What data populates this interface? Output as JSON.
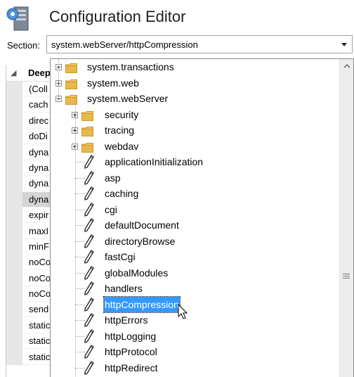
{
  "header": {
    "title": "Configuration Editor",
    "icon": "server-config-icon"
  },
  "section": {
    "label": "Section:",
    "value": "system.webServer/httpCompression"
  },
  "grid": {
    "header_label": "Deep",
    "rows": [
      "(Coll",
      "cach",
      "direc",
      "doDi",
      "dyna",
      "dyna",
      "dyna",
      "dyna",
      "expir",
      "maxI",
      "minF",
      "noCo",
      "noCo",
      "noCo",
      "send",
      "static",
      "static",
      "static"
    ],
    "selected_row_index": 7
  },
  "tree": {
    "items": [
      {
        "label": "system.transactions",
        "kind": "folder",
        "expander": "plus"
      },
      {
        "label": "system.web",
        "kind": "folder",
        "expander": "plus"
      },
      {
        "label": "system.webServer",
        "kind": "folder",
        "expander": "minus"
      },
      {
        "label": "security",
        "kind": "folder",
        "expander": "plus"
      },
      {
        "label": "tracing",
        "kind": "folder",
        "expander": "plus"
      },
      {
        "label": "webdav",
        "kind": "folder",
        "expander": "plus"
      },
      {
        "label": "applicationInitialization",
        "kind": "section"
      },
      {
        "label": "asp",
        "kind": "section"
      },
      {
        "label": "caching",
        "kind": "section"
      },
      {
        "label": "cgi",
        "kind": "section"
      },
      {
        "label": "defaultDocument",
        "kind": "section"
      },
      {
        "label": "directoryBrowse",
        "kind": "section"
      },
      {
        "label": "fastCgi",
        "kind": "section"
      },
      {
        "label": "globalModules",
        "kind": "section"
      },
      {
        "label": "handlers",
        "kind": "section"
      },
      {
        "label": "httpCompression",
        "kind": "section",
        "selected": true
      },
      {
        "label": "httpErrors",
        "kind": "section"
      },
      {
        "label": "httpLogging",
        "kind": "section"
      },
      {
        "label": "httpProtocol",
        "kind": "section"
      },
      {
        "label": "httpRedirect",
        "kind": "section"
      }
    ]
  },
  "colors": {
    "selection": "#3399ff",
    "folder": "#e8b84a"
  }
}
